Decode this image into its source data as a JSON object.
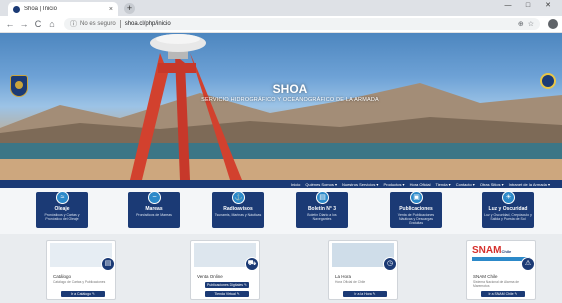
{
  "browser": {
    "tab_title": "Shoa | Inicio",
    "tab_close": "×",
    "new_tab": "+",
    "back_icon": "←",
    "forward_icon": "→",
    "reload_icon": "C",
    "home_icon": "⌂",
    "not_secure": "No es seguro",
    "url": "shoa.cl/php/inicio",
    "window_controls": [
      "—",
      "□",
      "✕"
    ]
  },
  "hero": {
    "title": "SHOA",
    "subtitle": "SERVICIO HIDROGRÁFICO Y OCEANOGRÁFICO DE LA ARMADA"
  },
  "navbar": {
    "items": [
      "Inicio",
      "Quiénes Somos ▾",
      "Nuestros Servicios ▾",
      "Productos ▾",
      "Hora Oficial",
      "Tienda ▾",
      "Contacto ▾",
      "Otras Sitios ▾",
      "Intranet de la Armada ▾"
    ]
  },
  "services": [
    {
      "icon": "≈",
      "title": "Oleaje",
      "desc": "Pronósticos y Cartas y Pronóstico del Oleaje"
    },
    {
      "icon": "~",
      "title": "Mareas",
      "desc": "Pronósticos de Mareas"
    },
    {
      "icon": "⚓",
      "title": "Radioavisos",
      "desc": "Tsunamis, Marinas y Náuticas"
    },
    {
      "icon": "▤",
      "title": "Boletín N° 3",
      "desc": "Boletín Diario a los Navegantes"
    },
    {
      "icon": "▣",
      "title": "Publicaciones",
      "desc": "Venta de Publicaciones Náuticas y Descargas Gratuitas"
    },
    {
      "icon": "☀",
      "title": "Luz y Oscuridad",
      "desc": "Luz y Oscuridad, Crepúsculo y Salida y Puesta de Sol"
    }
  ],
  "publications": [
    {
      "title": "Catálogo",
      "desc": "Catálogo de Cartas y Publicaciones",
      "buttons": [
        "Ir a Catálogo ✎"
      ]
    },
    {
      "title": "Venta Online",
      "desc": "",
      "buttons": [
        "Publicaciones Digitales ✎",
        "Tienda Virtual ✎"
      ]
    },
    {
      "title": "La Hora",
      "desc": "Hora Oficial de Chile",
      "buttons": [
        "Ir a la Hora ✎"
      ]
    },
    {
      "title": "SNAM Chile",
      "desc": "Sistema Nacional de Alarma de Maremotos",
      "buttons": [
        "Ir a SNAM Chile ✎"
      ]
    }
  ],
  "snam_logo": {
    "main": "SNAM",
    "small": "Chile"
  },
  "colors": {
    "primary": "#1b3a75",
    "accent": "#2c89c9",
    "gold": "#c9a43c"
  }
}
